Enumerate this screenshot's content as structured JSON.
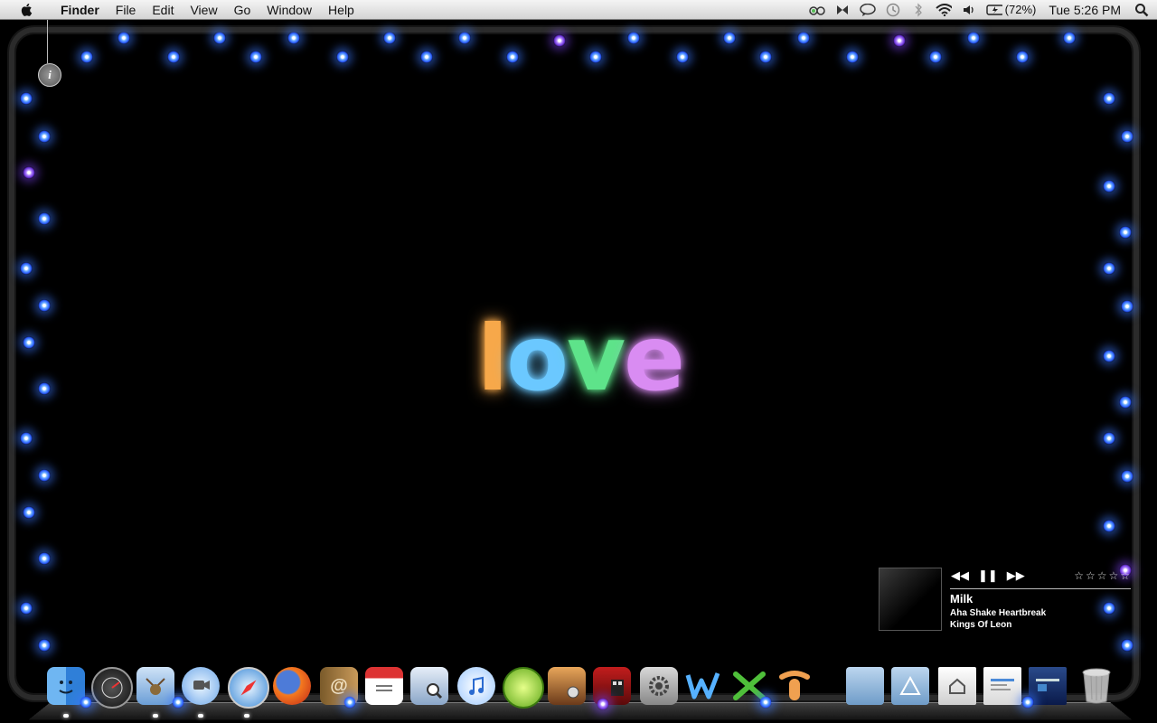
{
  "menubar": {
    "app_name": "Finder",
    "menus": [
      "File",
      "Edit",
      "View",
      "Go",
      "Window",
      "Help"
    ],
    "battery": "(72%)",
    "clock": "Tue 5:26 PM"
  },
  "desktop": {
    "wallpaper_text": [
      "l",
      "o",
      "v",
      "e"
    ],
    "wallpaper_colors": [
      "#f7a84a",
      "#6bc8ff",
      "#5ee38a",
      "#d98cf2"
    ],
    "info_button_label": "i"
  },
  "player": {
    "prev": "◀◀",
    "pause": "❚❚",
    "next": "▶▶",
    "rating": "☆☆☆☆☆",
    "track": "Milk",
    "album": "Aha Shake Heartbreak",
    "artist": "Kings Of Leon"
  }
}
